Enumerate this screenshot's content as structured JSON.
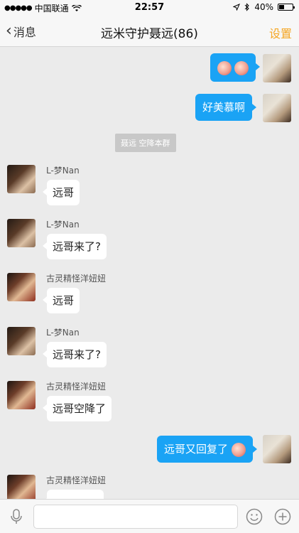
{
  "status_bar": {
    "carrier": "中国联通",
    "time": "22:57",
    "battery": "40%",
    "battery_level": 0.4
  },
  "nav": {
    "back_label": "消息",
    "title": "远米守护聂远(86)",
    "settings_label": "设置"
  },
  "colors": {
    "accent": "#f5a623",
    "outgoing_bubble": "#1aa3f5"
  },
  "system_message": "聂远 空降本群",
  "messages": [
    {
      "direction": "out",
      "text": "",
      "emoji": [
        "pig-face-emoji",
        "pig-face-emoji"
      ]
    },
    {
      "direction": "out",
      "text": "好美慕啊"
    },
    {
      "direction": "in",
      "sender": "L-梦Nan",
      "text": "远哥"
    },
    {
      "direction": "in",
      "sender": "L-梦Nan",
      "text": "远哥来了?"
    },
    {
      "direction": "in",
      "sender": "古灵精怪洋妞妞",
      "text": "远哥"
    },
    {
      "direction": "in",
      "sender": "L-梦Nan",
      "text": "远哥来了?"
    },
    {
      "direction": "in",
      "sender": "古灵精怪洋妞妞",
      "text": "远哥空降了"
    },
    {
      "direction": "out",
      "text": "远哥又回复了",
      "emoji": [
        "pig-face-emoji"
      ]
    },
    {
      "direction": "in",
      "sender": "古灵精怪洋妞妞",
      "text": ""
    }
  ]
}
